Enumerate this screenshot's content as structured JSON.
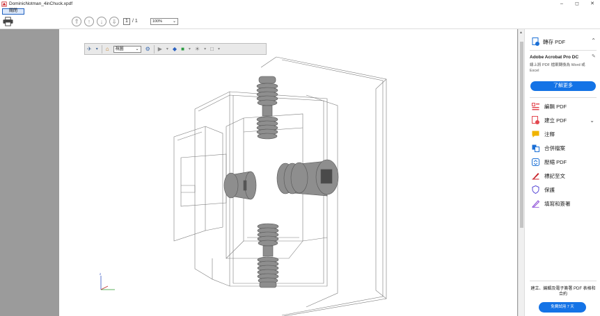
{
  "window": {
    "title": "DominicNotman_4inChuck.xpdf",
    "controls": [
      "–",
      "◻",
      "✕"
    ]
  },
  "menu": {
    "close_label": "關閉"
  },
  "toolbar": {
    "page_current": "1",
    "page_total": "/ 1",
    "zoom": "100%"
  },
  "viewer3d": {
    "view_select": "視圖"
  },
  "axis": {
    "z": "z"
  },
  "panel": {
    "export_label": "轉存 PDF",
    "promo_title": "Adobe Acrobat Pro DC",
    "promo_text": "線上將 PDF 檔案轉換為 Word 或 Excel",
    "learn_more": "了解更多",
    "tools": [
      {
        "label": "編輯 PDF",
        "icon": "edit-pdf-icon",
        "color": "#e34850"
      },
      {
        "label": "建立 PDF",
        "icon": "create-pdf-icon",
        "color": "#e34850"
      },
      {
        "label": "注釋",
        "icon": "comment-icon",
        "color": "#f0b400"
      },
      {
        "label": "合併檔案",
        "icon": "combine-icon",
        "color": "#1a6fd6"
      },
      {
        "label": "壓縮 PDF",
        "icon": "compress-icon",
        "color": "#1a6fd6"
      },
      {
        "label": "標記至文",
        "icon": "sign-icon",
        "color": "#c9252c"
      },
      {
        "label": "保護",
        "icon": "protect-icon",
        "color": "#5a4bd6"
      },
      {
        "label": "填寫和簽署",
        "icon": "fill-sign-icon",
        "color": "#8a4bd6"
      }
    ],
    "footer_text": "建立、編輯及電子簽署 PDF 表格和合約",
    "trial_button": "免費試用 7 天"
  },
  "colors": {
    "accent": "#1473e6",
    "doc_bg": "#9b9b9b"
  }
}
